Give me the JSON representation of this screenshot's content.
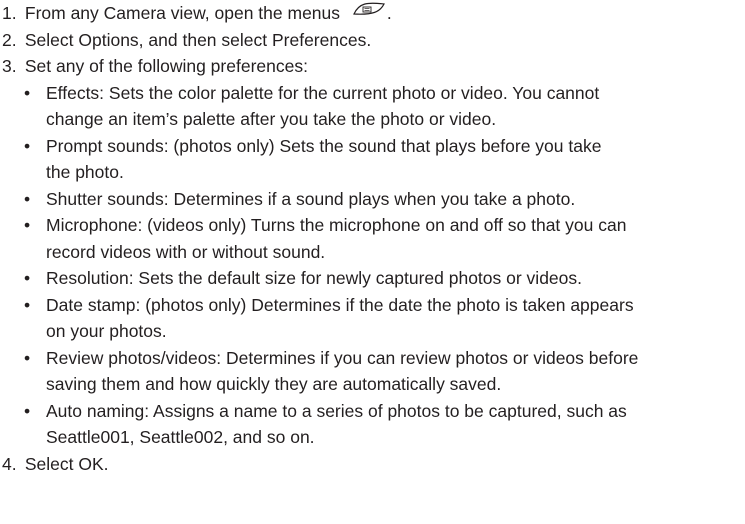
{
  "steps": [
    {
      "number": "1.",
      "text": "From any Camera view, open the menus",
      "trailing": "."
    },
    {
      "number": "2.",
      "text": "Select Options, and then select Preferences."
    },
    {
      "number": "3.",
      "text": "Set any of the following preferences:"
    },
    {
      "number": "4.",
      "text": "Select OK."
    }
  ],
  "icons": {
    "menu": "menu-key-icon"
  },
  "bullet_glyph": "•",
  "preferences": [
    {
      "term": "Effects:",
      "line1": " Sets the color palette for the current photo or video. You cannot",
      "line2": "change an item’s palette after you take the photo or video."
    },
    {
      "term": "Prompt sounds:",
      "line1": " (photos only) Sets the sound that plays before you take",
      "line2": "the photo."
    },
    {
      "term": "Shutter sounds:",
      "line1": " Determines if a sound plays when you take a photo.",
      "line2": ""
    },
    {
      "term": "Microphone:",
      "line1": " (videos only) Turns the microphone on and off so that you can",
      "line2": "record videos with or without sound."
    },
    {
      "term": "Resolution:",
      "line1": " Sets the default size for newly captured photos or videos.",
      "line2": ""
    },
    {
      "term": "Date stamp:",
      "line1": " (photos only) Determines if the date the photo is taken appears",
      "line2": "on your photos."
    },
    {
      "term": "Review photos/videos:",
      "line1": " Determines if you can review photos or videos before",
      "line2": "saving them and how quickly they are automatically saved."
    },
    {
      "term": "Auto naming:",
      "line1": " Assigns a name to a series of photos to be captured, such as",
      "line2": "Seattle001, Seattle002, and so on."
    }
  ]
}
